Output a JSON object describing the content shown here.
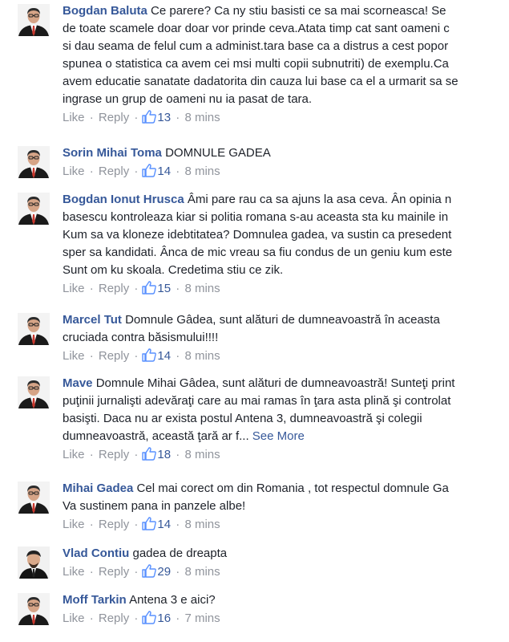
{
  "ui": {
    "like_label": "Like",
    "reply_label": "Reply",
    "separator": "·"
  },
  "comments": [
    {
      "author": "Bogdan Baluta",
      "lines": [
        "Ce parere? Ca ny stiu basisti ce sa mai scorneasca! Se",
        "de toate scamele doar doar vor prinde ceva.Atata timp cat sant oameni c",
        "si dau seama de felul cum a administ.tara base ca a distrus a cest popor",
        "spunea o statistica ca avem cei msi multi copii subnutriti) de exemplu.Ca",
        "avem educatie sanatate dadatorita din cauza lui base ca el a urmarit sa se",
        "ingrase un grup de oameni nu ia pasat de tara."
      ],
      "likes": "13",
      "time": "8 mins"
    },
    {
      "author": "Sorin Mihai Toma",
      "lines": [
        "DOMNULE GADEA"
      ],
      "likes": "14",
      "time": "8 mins"
    },
    {
      "author": "Bogdan Ionut Hrusca",
      "lines": [
        "Âmi pare rau ca sa ajuns la asa ceva. Ân opinia n",
        "basescu kontroleaza kiar si politia romana s-au aceasta sta ku mainile in",
        "Kum sa va kloneze idebtitatea? Domnulea gadea, va sustin ca presedent",
        "sper sa kandidati. Ânca de mic vreau sa fiu condus de un geniu kum este",
        "Sunt om ku skoala. Credetima stiu ce zik."
      ],
      "likes": "15",
      "time": "8 mins"
    },
    {
      "author": "Marcel Tut",
      "lines": [
        "Domnule Gâdea, sunt alături de dumneavoastră în aceasta",
        "cruciada contra băsismului!!!!"
      ],
      "likes": "14",
      "time": "8 mins"
    },
    {
      "author": "Mave",
      "lines": [
        "Domnule Mihai Gâdea, sunt alături de dumneavoastră! Sunteţi print",
        "puţinii jurnalişti adevăraţi care au mai ramas în ţara asta plină şi controlat",
        "basişti. Daca nu ar exista postul Antena 3, dumneavoastră şi colegii",
        "dumneavoastră, această ţară ar f..."
      ],
      "see_more": "See More",
      "likes": "18",
      "time": "8 mins"
    },
    {
      "author": "Mihai Gadea",
      "lines": [
        "Cel mai corect om din Romania , tot respectul domnule Ga",
        "Va sustinem pana in panzele albe!"
      ],
      "likes": "14",
      "time": "8 mins"
    },
    {
      "author": "Vlad Contiu",
      "lines": [
        "gadea de dreapta"
      ],
      "likes": "29",
      "time": "8 mins"
    },
    {
      "author": "Moff Tarkin",
      "lines": [
        "Antena 3 e aici?"
      ],
      "likes": "16",
      "time": "7 mins"
    }
  ]
}
